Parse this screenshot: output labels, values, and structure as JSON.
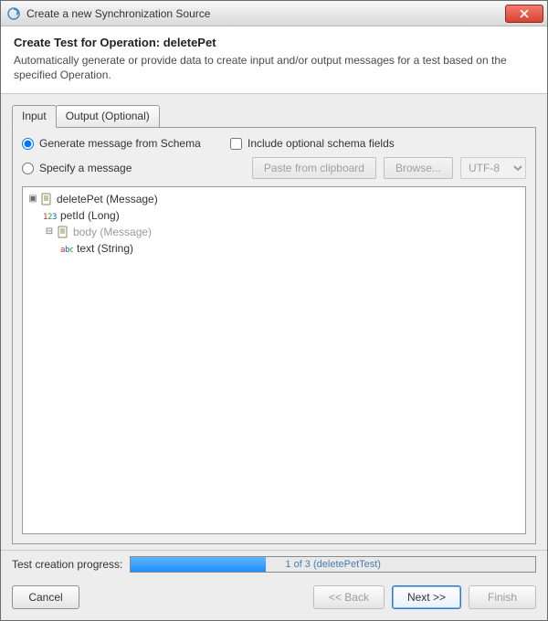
{
  "window": {
    "title": "Create a new Synchronization Source"
  },
  "header": {
    "title": "Create Test for Operation: deletePet",
    "description": "Automatically generate or provide data to create input and/or output messages for a test based on the specified Operation."
  },
  "tabs": {
    "input": "Input",
    "output": "Output (Optional)"
  },
  "options": {
    "generate_label": "Generate message from Schema",
    "include_optional_label": "Include optional schema fields",
    "specify_label": "Specify a message",
    "paste_label": "Paste from clipboard",
    "browse_label": "Browse...",
    "encoding_value": "UTF-8"
  },
  "tree": {
    "root": "deletePet (Message)",
    "petid": "petId (Long)",
    "body": "body (Message)",
    "text": "text (String)"
  },
  "progress": {
    "label": "Test creation progress:",
    "text": "1 of 3 (deletePetTest)",
    "percent": 33.3
  },
  "buttons": {
    "cancel": "Cancel",
    "back": "<< Back",
    "next": "Next >>",
    "finish": "Finish"
  }
}
